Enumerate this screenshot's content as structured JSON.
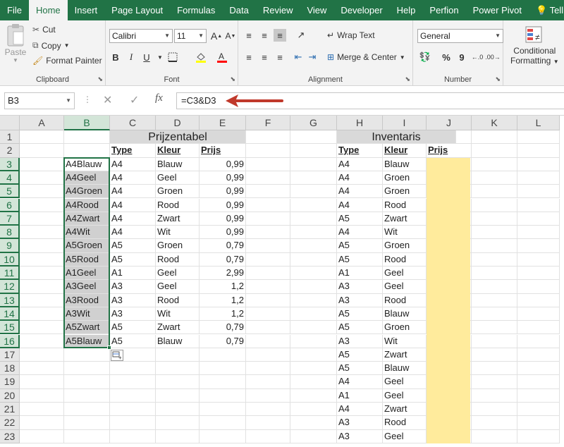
{
  "tabs": [
    "File",
    "Home",
    "Insert",
    "Page Layout",
    "Formulas",
    "Data",
    "Review",
    "View",
    "Developer",
    "Help",
    "Perfion",
    "Power Pivot",
    "Tell m"
  ],
  "active_tab": "Home",
  "clipboard": {
    "paste": "Paste",
    "cut": "Cut",
    "copy": "Copy",
    "format_painter": "Format Painter",
    "label": "Clipboard"
  },
  "font": {
    "name": "Calibri",
    "size": "11",
    "label": "Font",
    "bold": "B",
    "italic": "I",
    "underline": "U"
  },
  "alignment": {
    "wrap": "Wrap Text",
    "merge": "Merge & Center",
    "label": "Alignment"
  },
  "number": {
    "format": "General",
    "label": "Number",
    "percent": "%"
  },
  "styles": {
    "conditional": "Conditional",
    "formatting": "Formatting"
  },
  "namebox": "B3",
  "formula": "=C3&D3",
  "columns": [
    "A",
    "B",
    "C",
    "D",
    "E",
    "F",
    "G",
    "H",
    "I",
    "J",
    "K",
    "L"
  ],
  "rows": [
    "1",
    "2",
    "3",
    "4",
    "5",
    "6",
    "7",
    "8",
    "9",
    "10",
    "11",
    "12",
    "13",
    "14",
    "15",
    "16",
    "17",
    "18",
    "19",
    "20",
    "21",
    "22",
    "23"
  ],
  "prijzentabel": {
    "title": "Prijzentabel",
    "headers": [
      "Type",
      "Kleur",
      "Prijs"
    ],
    "keys": [
      "A4Blauw",
      "A4Geel",
      "A4Groen",
      "A4Rood",
      "A4Zwart",
      "A4Wit",
      "A5Groen",
      "A5Rood",
      "A1Geel",
      "A3Geel",
      "A3Rood",
      "A3Wit",
      "A5Zwart",
      "A5Blauw"
    ],
    "type": [
      "A4",
      "A4",
      "A4",
      "A4",
      "A4",
      "A4",
      "A5",
      "A5",
      "A1",
      "A3",
      "A3",
      "A3",
      "A5",
      "A5"
    ],
    "kleur": [
      "Blauw",
      "Geel",
      "Groen",
      "Rood",
      "Zwart",
      "Wit",
      "Groen",
      "Rood",
      "Geel",
      "Geel",
      "Rood",
      "Wit",
      "Zwart",
      "Blauw"
    ],
    "prijs": [
      "0,99",
      "0,99",
      "0,99",
      "0,99",
      "0,99",
      "0,99",
      "0,79",
      "0,79",
      "2,99",
      "1,2",
      "1,2",
      "1,2",
      "0,79",
      "0,79"
    ]
  },
  "inventaris": {
    "title": "Inventaris",
    "headers": [
      "Type",
      "Kleur",
      "Prijs"
    ],
    "type": [
      "A4",
      "A4",
      "A4",
      "A4",
      "A5",
      "A4",
      "A5",
      "A5",
      "A1",
      "A3",
      "A3",
      "A5",
      "A5",
      "A3",
      "A5",
      "A5",
      "A4",
      "A1",
      "A4",
      "A3",
      "A3"
    ],
    "kleur": [
      "Blauw",
      "Groen",
      "Groen",
      "Rood",
      "Zwart",
      "Wit",
      "Groen",
      "Rood",
      "Geel",
      "Geel",
      "Rood",
      "Blauw",
      "Groen",
      "Wit",
      "Zwart",
      "Blauw",
      "Geel",
      "Geel",
      "Zwart",
      "Rood",
      "Geel"
    ]
  },
  "colors": {
    "excel_green": "#217346",
    "highlight_yellow": "#ffeb9c",
    "title_gray": "#d9d9d9",
    "selection_gray": "#d0d0d0",
    "arrow_red": "#c0392b"
  }
}
